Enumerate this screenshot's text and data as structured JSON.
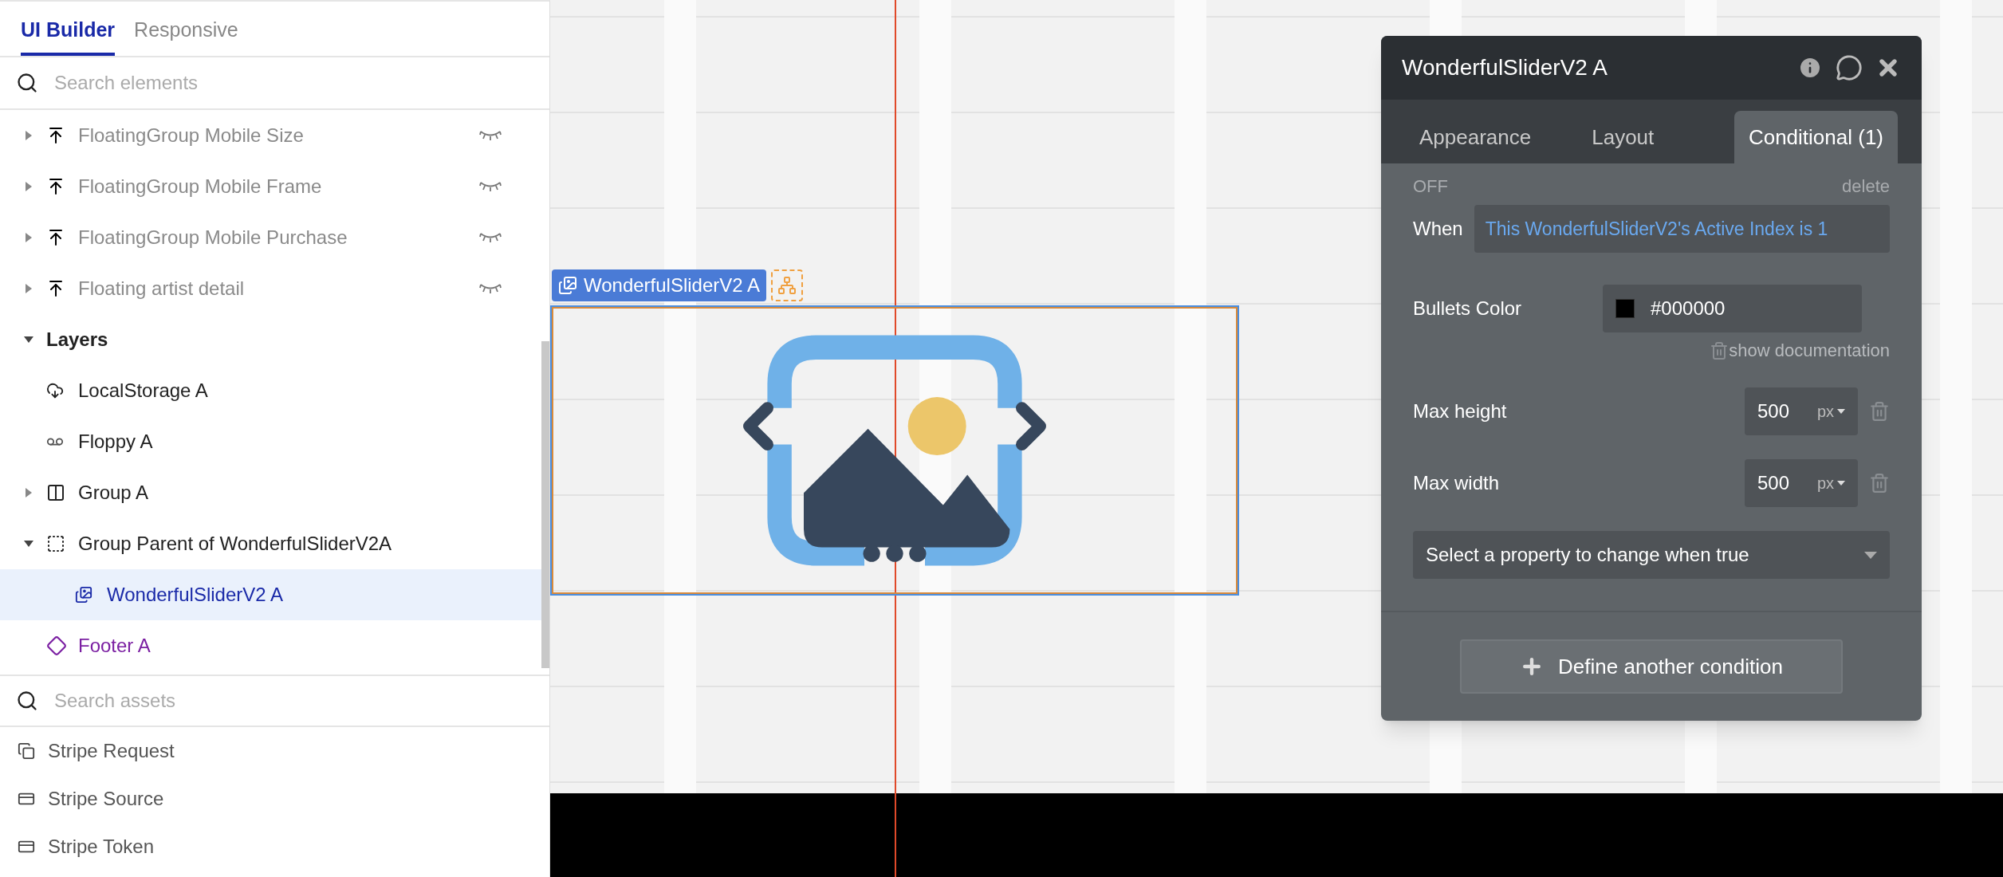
{
  "left_panel": {
    "tabs": [
      {
        "label": "UI Builder",
        "selected": true
      },
      {
        "label": "Responsive",
        "selected": false
      }
    ],
    "element_search": {
      "placeholder": "Search elements"
    },
    "element_tree": [
      {
        "label": "FloatingGroup Mobile Size",
        "kind": "floating",
        "hidden": true,
        "expanded": false,
        "selected": false
      },
      {
        "label": "FloatingGroup Mobile Frame",
        "kind": "floating",
        "hidden": true,
        "expanded": false,
        "selected": false
      },
      {
        "label": "FloatingGroup Mobile Purchase",
        "kind": "floating",
        "hidden": true,
        "expanded": false,
        "selected": false
      },
      {
        "label": "Floating artist detail",
        "kind": "floating",
        "hidden": true,
        "expanded": false,
        "selected": false
      },
      {
        "label": "Layers",
        "kind": "section",
        "hidden": false,
        "expanded": true,
        "selected": false,
        "children": [
          {
            "label": "LocalStorage A",
            "kind": "storage",
            "hidden": false,
            "selected": false
          },
          {
            "label": "Floppy A",
            "kind": "floppy",
            "hidden": false,
            "selected": false
          },
          {
            "label": "Group A",
            "kind": "group",
            "hidden": false,
            "expanded": false,
            "selected": false
          },
          {
            "label": "Group Parent of WonderfulSliderV2A",
            "kind": "group_focus",
            "hidden": false,
            "expanded": true,
            "selected": false,
            "children": [
              {
                "label": "WonderfulSliderV2 A",
                "kind": "slider",
                "hidden": false,
                "selected": true
              }
            ]
          },
          {
            "label": "Footer A",
            "kind": "footer",
            "hidden": false,
            "selected": false
          }
        ]
      }
    ],
    "asset_search": {
      "placeholder": "Search assets"
    },
    "assets": [
      {
        "label": "Stripe Request",
        "kind": "request"
      },
      {
        "label": "Stripe Source",
        "kind": "card"
      },
      {
        "label": "Stripe Token",
        "kind": "card"
      }
    ]
  },
  "canvas": {
    "element_label": "WonderfulSliderV2 A"
  },
  "property_panel": {
    "title": "WonderfulSliderV2 A",
    "tabs": [
      {
        "label": "Appearance",
        "selected": false
      },
      {
        "label": "Layout",
        "selected": false
      },
      {
        "label": "Conditional (1)",
        "selected": true
      }
    ],
    "condition": {
      "status": "OFF",
      "delete_label": "delete",
      "when_label": "When",
      "expression": "This WonderfulSliderV2's Active Index is 1",
      "properties": [
        {
          "kind": "color",
          "label": "Bullets Color",
          "value": "#000000",
          "link": "show documentation"
        },
        {
          "kind": "length",
          "label": "Max height",
          "value": "500",
          "unit": "px"
        },
        {
          "kind": "length",
          "label": "Max width",
          "value": "500",
          "unit": "px"
        }
      ],
      "select_placeholder": "Select a property to change when true"
    },
    "add_button": "Define another condition"
  }
}
